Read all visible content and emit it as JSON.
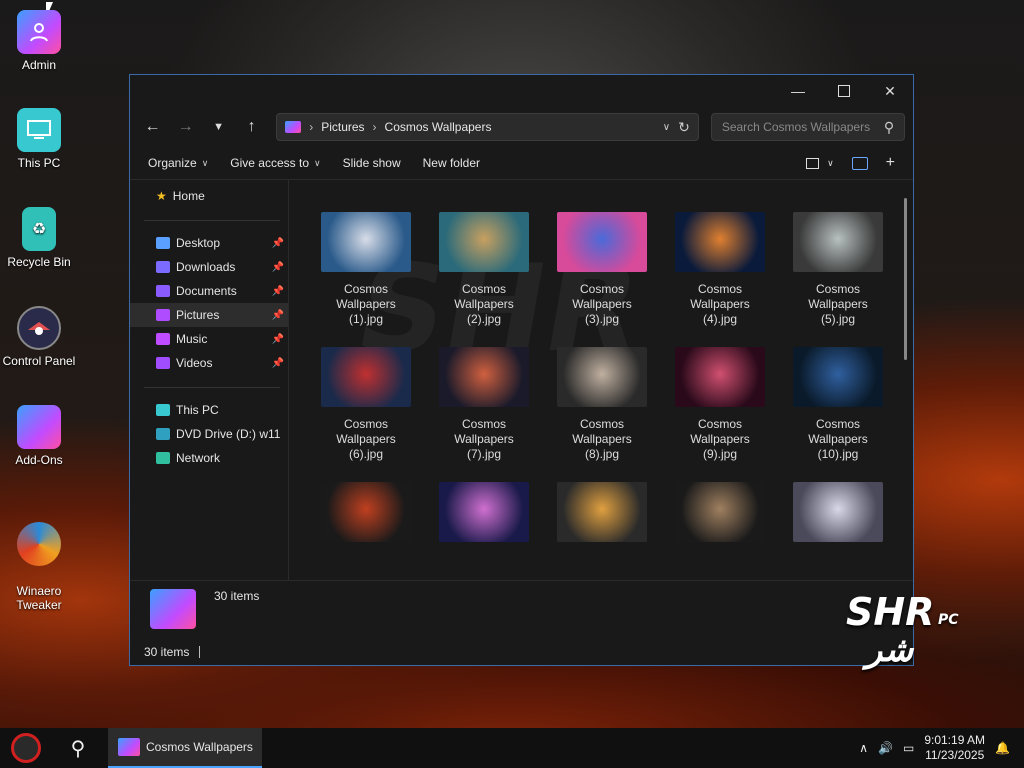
{
  "desktop": {
    "icons": [
      {
        "label": "Admin",
        "icon": "user-folder-icon"
      },
      {
        "label": "This PC",
        "icon": "monitor-icon"
      },
      {
        "label": "Recycle Bin",
        "icon": "recycle-bin-icon"
      },
      {
        "label": "Control Panel",
        "icon": "control-panel-icon"
      },
      {
        "label": "Add-Ons",
        "icon": "folder-icon"
      },
      {
        "label": "Winaero\nTweaker",
        "icon": "winaero-tweaker-icon"
      }
    ]
  },
  "window": {
    "breadcrumb": [
      "Pictures",
      "Cosmos Wallpapers"
    ],
    "search_placeholder": "Search Cosmos Wallpapers",
    "commands": {
      "organize": "Organize",
      "give_access": "Give access to",
      "slide_show": "Slide show",
      "new_folder": "New folder"
    },
    "nav": {
      "home": "Home",
      "quick": [
        {
          "label": "Desktop",
          "color": "#5aa0ff"
        },
        {
          "label": "Downloads",
          "color": "#7b6bff"
        },
        {
          "label": "Documents",
          "color": "#8a5cff"
        },
        {
          "label": "Pictures",
          "color": "#b04cff"
        },
        {
          "label": "Music",
          "color": "#c04cff"
        },
        {
          "label": "Videos",
          "color": "#a04cff"
        }
      ],
      "this_pc": "This PC",
      "dvd": "DVD Drive (D:) w11",
      "network": "Network"
    },
    "files": [
      {
        "name": "Cosmos\nWallpapers\n(1).jpg",
        "c1": "#2a5a8a",
        "c2": "#d8dde8"
      },
      {
        "name": "Cosmos\nWallpapers\n(2).jpg",
        "c1": "#2a6a7a",
        "c2": "#c8a060"
      },
      {
        "name": "Cosmos\nWallpapers\n(3).jpg",
        "c1": "#d84a9a",
        "c2": "#4a6ad8"
      },
      {
        "name": "Cosmos\nWallpapers\n(4).jpg",
        "c1": "#0a1a3a",
        "c2": "#e08030"
      },
      {
        "name": "Cosmos\nWallpapers\n(5).jpg",
        "c1": "#3a3a3a",
        "c2": "#b8c0c0"
      },
      {
        "name": "Cosmos\nWallpapers\n(6).jpg",
        "c1": "#1a2a4a",
        "c2": "#c03030"
      },
      {
        "name": "Cosmos\nWallpapers\n(7).jpg",
        "c1": "#1a1a2a",
        "c2": "#d06040"
      },
      {
        "name": "Cosmos\nWallpapers\n(8).jpg",
        "c1": "#2a2a2a",
        "c2": "#c0b0a0"
      },
      {
        "name": "Cosmos\nWallpapers\n(9).jpg",
        "c1": "#2a0a1a",
        "c2": "#d05070"
      },
      {
        "name": "Cosmos\nWallpapers\n(10).jpg",
        "c1": "#0a1a2a",
        "c2": "#3060a0"
      },
      {
        "name": "",
        "c1": "#1a1a1a",
        "c2": "#c04020"
      },
      {
        "name": "",
        "c1": "#1a1a4a",
        "c2": "#d070d0"
      },
      {
        "name": "",
        "c1": "#2a2a2a",
        "c2": "#e0a040"
      },
      {
        "name": "",
        "c1": "#1a1a1a",
        "c2": "#a08060"
      },
      {
        "name": "",
        "c1": "#4a4a5a",
        "c2": "#d8d8e8"
      }
    ],
    "details_count": "30 items",
    "status_count": "30 items"
  },
  "taskbar": {
    "app_label": "Cosmos Wallpapers",
    "time": "9:01:19 AM",
    "date": "11/23/2025"
  },
  "branding": {
    "logo_text": "SHR",
    "logo_sub": "PC",
    "logo_arabic": "شر"
  }
}
